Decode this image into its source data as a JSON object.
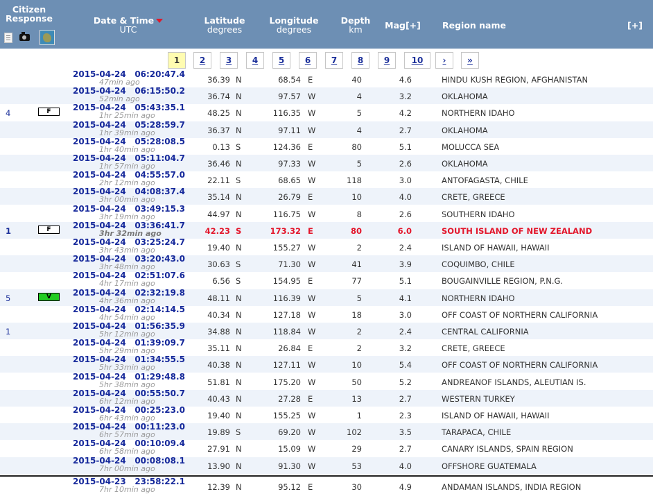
{
  "header": {
    "citizen_label": "Citizen Response",
    "date_label": "Date & Time",
    "date_sub": "UTC",
    "lat_label": "Latitude",
    "lat_sub": "degrees",
    "lon_label": "Longitude",
    "lon_sub": "degrees",
    "depth_label": "Depth",
    "depth_sub": "km",
    "mag_label": "Mag[+]",
    "region_label": "Region name",
    "expand_label": "[+]"
  },
  "pager": {
    "pages": [
      "1",
      "2",
      "3",
      "4",
      "5",
      "6",
      "7",
      "8",
      "9",
      "10"
    ],
    "current": "1",
    "next": "›",
    "last": "»"
  },
  "rows": [
    {
      "date": "2015-04-24",
      "time": "06:20:47.4",
      "ago": "47min ago",
      "lat": "36.39",
      "ns": "N",
      "lon": "68.54",
      "ew": "E",
      "depth": "40",
      "mag": "4.6",
      "region": "HINDU KUSH REGION, AFGHANISTAN",
      "count": "",
      "badge": ""
    },
    {
      "date": "2015-04-24",
      "time": "06:15:50.2",
      "ago": "52min ago",
      "lat": "36.74",
      "ns": "N",
      "lon": "97.57",
      "ew": "W",
      "depth": "4",
      "mag": "3.2",
      "region": "OKLAHOMA",
      "count": "",
      "badge": ""
    },
    {
      "date": "2015-04-24",
      "time": "05:43:35.1",
      "ago": "1hr 25min ago",
      "lat": "48.25",
      "ns": "N",
      "lon": "116.35",
      "ew": "W",
      "depth": "5",
      "mag": "4.2",
      "region": "NORTHERN IDAHO",
      "count": "4",
      "badge": "F"
    },
    {
      "date": "2015-04-24",
      "time": "05:28:59.7",
      "ago": "1hr 39min ago",
      "lat": "36.37",
      "ns": "N",
      "lon": "97.11",
      "ew": "W",
      "depth": "4",
      "mag": "2.7",
      "region": "OKLAHOMA",
      "count": "",
      "badge": ""
    },
    {
      "date": "2015-04-24",
      "time": "05:28:08.5",
      "ago": "1hr 40min ago",
      "lat": "0.13",
      "ns": "S",
      "lon": "124.36",
      "ew": "E",
      "depth": "80",
      "mag": "5.1",
      "region": "MOLUCCA SEA",
      "count": "",
      "badge": ""
    },
    {
      "date": "2015-04-24",
      "time": "05:11:04.7",
      "ago": "1hr 57min ago",
      "lat": "36.46",
      "ns": "N",
      "lon": "97.33",
      "ew": "W",
      "depth": "5",
      "mag": "2.6",
      "region": "OKLAHOMA",
      "count": "",
      "badge": ""
    },
    {
      "date": "2015-04-24",
      "time": "04:55:57.0",
      "ago": "2hr 12min ago",
      "lat": "22.11",
      "ns": "S",
      "lon": "68.65",
      "ew": "W",
      "depth": "118",
      "mag": "3.0",
      "region": "ANTOFAGASTA, CHILE",
      "count": "",
      "badge": ""
    },
    {
      "date": "2015-04-24",
      "time": "04:08:37.4",
      "ago": "3hr 00min ago",
      "lat": "35.14",
      "ns": "N",
      "lon": "26.79",
      "ew": "E",
      "depth": "10",
      "mag": "4.0",
      "region": "CRETE, GREECE",
      "count": "",
      "badge": ""
    },
    {
      "date": "2015-04-24",
      "time": "03:49:15.3",
      "ago": "3hr 19min ago",
      "lat": "44.97",
      "ns": "N",
      "lon": "116.75",
      "ew": "W",
      "depth": "8",
      "mag": "2.6",
      "region": "SOUTHERN IDAHO",
      "count": "",
      "badge": ""
    },
    {
      "date": "2015-04-24",
      "time": "03:36:41.7",
      "ago": "3hr 32min ago",
      "lat": "42.23",
      "ns": "S",
      "lon": "173.32",
      "ew": "E",
      "depth": "80",
      "mag": "6.0",
      "region": "SOUTH ISLAND OF NEW ZEALAND",
      "count": "1",
      "badge": "F",
      "big": true
    },
    {
      "date": "2015-04-24",
      "time": "03:25:24.7",
      "ago": "3hr 43min ago",
      "lat": "19.40",
      "ns": "N",
      "lon": "155.27",
      "ew": "W",
      "depth": "2",
      "mag": "2.4",
      "region": "ISLAND OF HAWAII, HAWAII",
      "count": "",
      "badge": ""
    },
    {
      "date": "2015-04-24",
      "time": "03:20:43.0",
      "ago": "3hr 48min ago",
      "lat": "30.63",
      "ns": "S",
      "lon": "71.30",
      "ew": "W",
      "depth": "41",
      "mag": "3.9",
      "region": "COQUIMBO, CHILE",
      "count": "",
      "badge": ""
    },
    {
      "date": "2015-04-24",
      "time": "02:51:07.6",
      "ago": "4hr 17min ago",
      "lat": "6.56",
      "ns": "S",
      "lon": "154.95",
      "ew": "E",
      "depth": "77",
      "mag": "5.1",
      "region": "BOUGAINVILLE REGION, P.N.G.",
      "count": "",
      "badge": ""
    },
    {
      "date": "2015-04-24",
      "time": "02:32:19.8",
      "ago": "4hr 36min ago",
      "lat": "48.11",
      "ns": "N",
      "lon": "116.39",
      "ew": "W",
      "depth": "5",
      "mag": "4.1",
      "region": "NORTHERN IDAHO",
      "count": "5",
      "badge": "V"
    },
    {
      "date": "2015-04-24",
      "time": "02:14:14.5",
      "ago": "4hr 54min ago",
      "lat": "40.34",
      "ns": "N",
      "lon": "127.18",
      "ew": "W",
      "depth": "18",
      "mag": "3.0",
      "region": "OFF COAST OF NORTHERN CALIFORNIA",
      "count": "",
      "badge": ""
    },
    {
      "date": "2015-04-24",
      "time": "01:56:35.9",
      "ago": "5hr 12min ago",
      "lat": "34.88",
      "ns": "N",
      "lon": "118.84",
      "ew": "W",
      "depth": "2",
      "mag": "2.4",
      "region": "CENTRAL CALIFORNIA",
      "count": "1",
      "badge": ""
    },
    {
      "date": "2015-04-24",
      "time": "01:39:09.7",
      "ago": "5hr 29min ago",
      "lat": "35.11",
      "ns": "N",
      "lon": "26.84",
      "ew": "E",
      "depth": "2",
      "mag": "3.2",
      "region": "CRETE, GREECE",
      "count": "",
      "badge": ""
    },
    {
      "date": "2015-04-24",
      "time": "01:34:55.5",
      "ago": "5hr 33min ago",
      "lat": "40.38",
      "ns": "N",
      "lon": "127.11",
      "ew": "W",
      "depth": "10",
      "mag": "5.4",
      "region": "OFF COAST OF NORTHERN CALIFORNIA",
      "count": "",
      "badge": ""
    },
    {
      "date": "2015-04-24",
      "time": "01:29:48.8",
      "ago": "5hr 38min ago",
      "lat": "51.81",
      "ns": "N",
      "lon": "175.20",
      "ew": "W",
      "depth": "50",
      "mag": "5.2",
      "region": "ANDREANOF ISLANDS, ALEUTIAN IS.",
      "count": "",
      "badge": ""
    },
    {
      "date": "2015-04-24",
      "time": "00:55:50.7",
      "ago": "6hr 12min ago",
      "lat": "40.43",
      "ns": "N",
      "lon": "27.28",
      "ew": "E",
      "depth": "13",
      "mag": "2.7",
      "region": "WESTERN TURKEY",
      "count": "",
      "badge": ""
    },
    {
      "date": "2015-04-24",
      "time": "00:25:23.0",
      "ago": "6hr 43min ago",
      "lat": "19.40",
      "ns": "N",
      "lon": "155.25",
      "ew": "W",
      "depth": "1",
      "mag": "2.3",
      "region": "ISLAND OF HAWAII, HAWAII",
      "count": "",
      "badge": ""
    },
    {
      "date": "2015-04-24",
      "time": "00:11:23.0",
      "ago": "6hr 57min ago",
      "lat": "19.89",
      "ns": "S",
      "lon": "69.20",
      "ew": "W",
      "depth": "102",
      "mag": "3.5",
      "region": "TARAPACA, CHILE",
      "count": "",
      "badge": ""
    },
    {
      "date": "2015-04-24",
      "time": "00:10:09.4",
      "ago": "6hr 58min ago",
      "lat": "27.91",
      "ns": "N",
      "lon": "15.09",
      "ew": "W",
      "depth": "29",
      "mag": "2.7",
      "region": "CANARY ISLANDS, SPAIN REGION",
      "count": "",
      "badge": ""
    },
    {
      "date": "2015-04-24",
      "time": "00:08:08.1",
      "ago": "7hr 00min ago",
      "lat": "13.90",
      "ns": "N",
      "lon": "91.30",
      "ew": "W",
      "depth": "53",
      "mag": "4.0",
      "region": "OFFSHORE GUATEMALA",
      "count": "",
      "badge": ""
    },
    {
      "date": "2015-04-23",
      "time": "23:58:22.1",
      "ago": "7hr 10min ago",
      "lat": "12.39",
      "ns": "N",
      "lon": "95.12",
      "ew": "E",
      "depth": "30",
      "mag": "4.9",
      "region": "ANDAMAN ISLANDS, INDIA REGION",
      "count": "",
      "badge": ""
    }
  ],
  "icons": [
    "document-icon",
    "camera-icon",
    "map-icon",
    "sort-desc-icon"
  ],
  "colors": {
    "header_bg": "#6d8fb4",
    "link": "#16299b",
    "highlight": "#e3162b",
    "current_page": "#fffcb1",
    "alt_row": "#eef3fa",
    "badge_v": "#22cc22"
  }
}
